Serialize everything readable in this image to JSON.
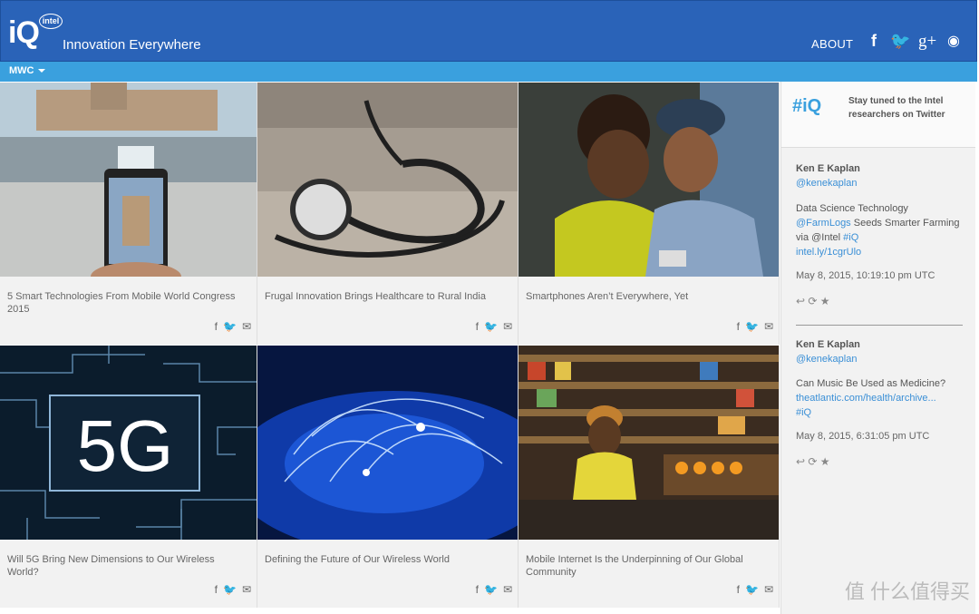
{
  "header": {
    "logo_text": "iQ",
    "logo_badge": "intel",
    "tagline": "Innovation Everywhere",
    "about": "ABOUT",
    "icons": [
      "facebook-icon",
      "twitter-icon",
      "googleplus-icon",
      "rss-icon"
    ],
    "facebook_glyph": "f",
    "twitter_glyph": "🐦",
    "gplus_glyph": "g+",
    "rss_glyph": "◉"
  },
  "subnav": {
    "label": "MWC"
  },
  "cards": [
    {
      "title": "5 Smart Technologies From Mobile World Congress 2015"
    },
    {
      "title": "Frugal Innovation Brings Healthcare to Rural India"
    },
    {
      "title": "Smartphones Aren’t Everywhere, Yet"
    },
    {
      "title": "Will 5G Bring New Dimensions to Our Wireless World?"
    },
    {
      "title": "Defining the Future of Our Wireless World"
    },
    {
      "title": "Mobile Internet Is the Underpinning of Our Global Community"
    }
  ],
  "share": {
    "facebook": "f",
    "twitter": "🐦",
    "email": "✉"
  },
  "sidebar": {
    "heading": "#iQ",
    "tagline": "Stay tuned to the Intel researchers on Twitter",
    "tweets": [
      {
        "name": "Ken E Kaplan",
        "handle": "@kenekaplan",
        "text": "Data Science Technology ",
        "link1": "@FarmLogs",
        "text2": " Seeds Smarter Farming via @Intel ",
        "link2": "#iQ",
        "link3": "intel.ly/1cgrUlo",
        "time": "May 8, 2015, 10:19:10 pm UTC"
      },
      {
        "name": "Ken E Kaplan",
        "handle": "@kenekaplan",
        "text": "Can Music Be Used as Medicine?",
        "link1": "theatlantic.com/health/archive...",
        "link2": "#iQ",
        "time": "May 8, 2015, 6:31:05 pm UTC"
      }
    ],
    "actions": "↩ ⟳ ★"
  },
  "watermark": "值 什么值得买"
}
